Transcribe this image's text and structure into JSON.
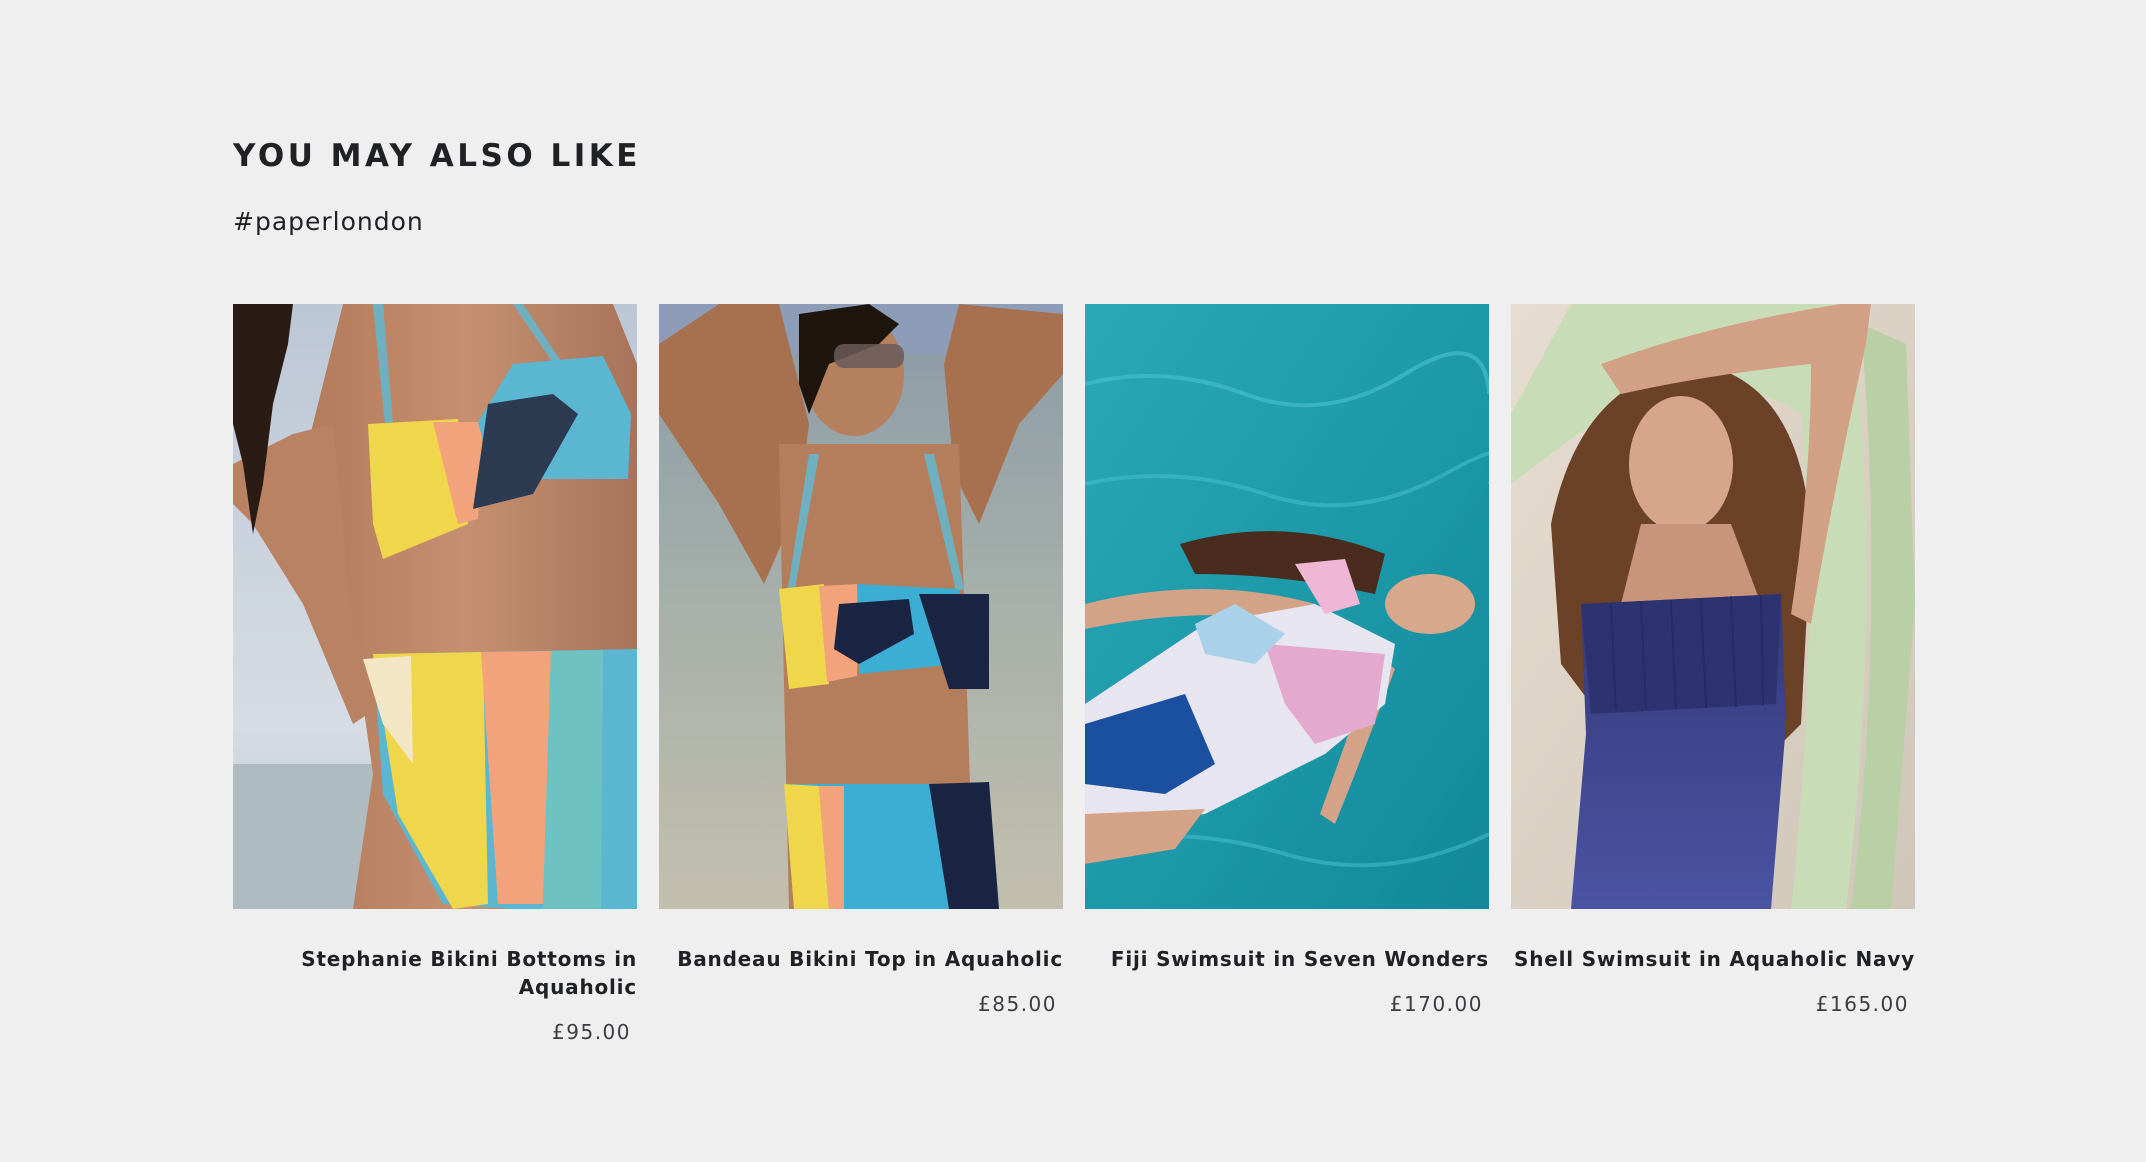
{
  "section": {
    "title": "YOU MAY ALSO LIKE",
    "hashtag": "#paperlondon"
  },
  "products": [
    {
      "name": "Stephanie Bikini Bottoms in Aquaholic",
      "price": "£95.00",
      "image_icon": "bikini-bottoms-photo"
    },
    {
      "name": "Bandeau Bikini Top in Aquaholic",
      "price": "£85.00",
      "image_icon": "bikini-top-photo"
    },
    {
      "name": "Fiji Swimsuit in Seven Wonders",
      "price": "£170.00",
      "image_icon": "swimsuit-pool-photo"
    },
    {
      "name": "Shell Swimsuit in Aquaholic Navy",
      "price": "£165.00",
      "image_icon": "navy-swimsuit-photo"
    }
  ],
  "colors": {
    "background": "#f0eff0",
    "text": "#1f2125",
    "price_text": "#3b3d41"
  }
}
